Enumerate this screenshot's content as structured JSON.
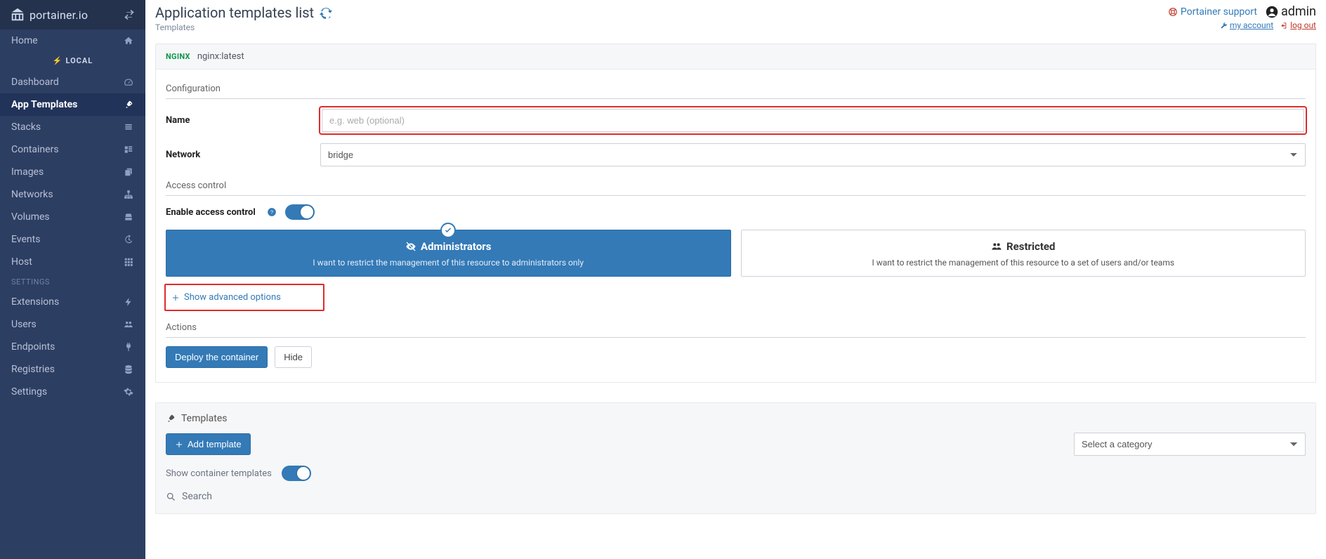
{
  "brand": {
    "name": "portainer.io"
  },
  "header": {
    "title": "Application templates list",
    "breadcrumb": "Templates",
    "support": "Portainer support",
    "user": "admin",
    "my_account": "my account",
    "log_out": "log out"
  },
  "sidebar": {
    "home": "Home",
    "local": "LOCAL",
    "items": [
      {
        "label": "Dashboard",
        "icon": "tachometer-icon"
      },
      {
        "label": "App Templates",
        "icon": "plug-icon"
      },
      {
        "label": "Stacks",
        "icon": "list-icon"
      },
      {
        "label": "Containers",
        "icon": "layers-icon"
      },
      {
        "label": "Images",
        "icon": "copy-icon"
      },
      {
        "label": "Networks",
        "icon": "sitemap-icon"
      },
      {
        "label": "Volumes",
        "icon": "hdd-icon"
      },
      {
        "label": "Events",
        "icon": "history-icon"
      },
      {
        "label": "Host",
        "icon": "grid-icon"
      }
    ],
    "settings_label": "SETTINGS",
    "settings": [
      {
        "label": "Extensions",
        "icon": "bolt-icon"
      },
      {
        "label": "Users",
        "icon": "users-icon"
      },
      {
        "label": "Endpoints",
        "icon": "plug2-icon"
      },
      {
        "label": "Registries",
        "icon": "database-icon"
      },
      {
        "label": "Settings",
        "icon": "cogs-icon"
      }
    ]
  },
  "template": {
    "image": "nginx:latest",
    "logo_text": "NGINX"
  },
  "config": {
    "section": "Configuration",
    "name_label": "Name",
    "name_placeholder": "e.g. web (optional)",
    "name_value": "",
    "network_label": "Network",
    "network_value": "bridge"
  },
  "access": {
    "section": "Access control",
    "enable_label": "Enable access control",
    "card_admin_title": "Administrators",
    "card_admin_sub": "I want to restrict the management of this resource to administrators only",
    "card_restricted_title": "Restricted",
    "card_restricted_sub": "I want to restrict the management of this resource to a set of users and/or teams"
  },
  "advanced": {
    "show": "Show advanced options"
  },
  "actions": {
    "section": "Actions",
    "deploy": "Deploy the container",
    "hide": "Hide"
  },
  "templates": {
    "title": "Templates",
    "add": "Add template",
    "category_placeholder": "Select a category",
    "show_container": "Show container templates",
    "search": "Search"
  }
}
